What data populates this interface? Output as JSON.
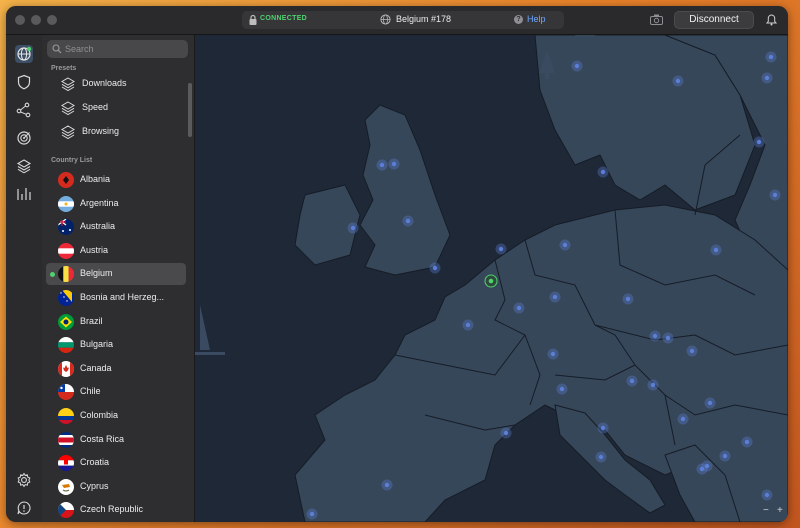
{
  "titlebar": {
    "status": "CONNECTED",
    "server": "Belgium #178",
    "help": "Help",
    "disconnect": "Disconnect"
  },
  "search": {
    "placeholder": "Search"
  },
  "presets_label": "Presets",
  "presets": [
    "Downloads",
    "Speed",
    "Browsing"
  ],
  "country_list_label": "Country List",
  "countries": [
    {
      "name": "Albania"
    },
    {
      "name": "Argentina"
    },
    {
      "name": "Australia"
    },
    {
      "name": "Austria"
    },
    {
      "name": "Belgium",
      "selected": true
    },
    {
      "name": "Bosnia and Herzeg..."
    },
    {
      "name": "Brazil"
    },
    {
      "name": "Bulgaria"
    },
    {
      "name": "Canada"
    },
    {
      "name": "Chile"
    },
    {
      "name": "Colombia"
    },
    {
      "name": "Costa Rica"
    },
    {
      "name": "Croatia"
    },
    {
      "name": "Cyprus"
    },
    {
      "name": "Czech Republic"
    }
  ],
  "map": {
    "zoom_out": "−",
    "zoom_in": "+"
  },
  "colors": {
    "connected": "#4fd16e",
    "accent_link": "#6ea7ff",
    "map_sea": "#1f2836",
    "map_land": "#37475a",
    "server_pin": "#5b7fd6",
    "active_pin": "#4fd16e"
  }
}
